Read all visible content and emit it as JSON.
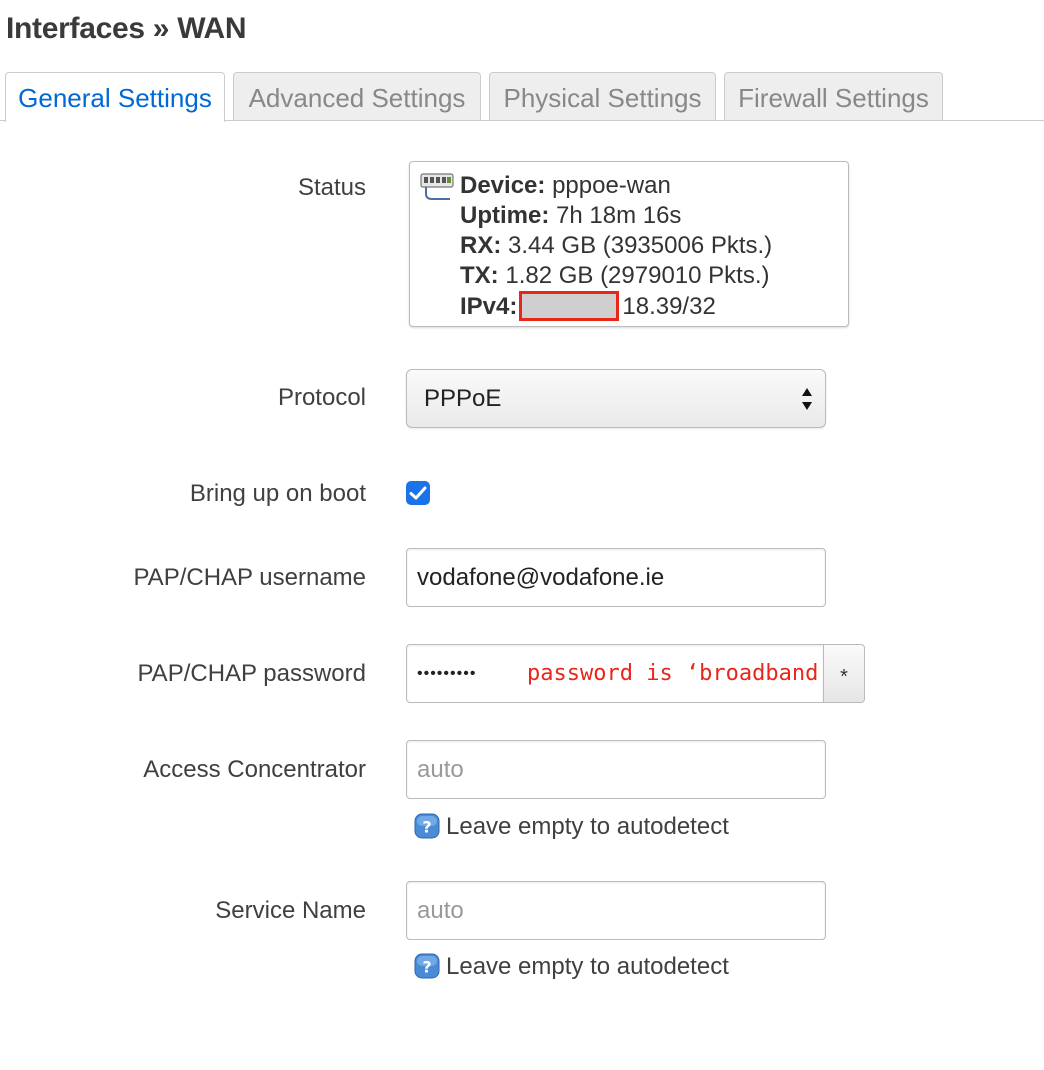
{
  "page": {
    "title": "Interfaces » WAN"
  },
  "tabs": [
    {
      "label": "General Settings",
      "active": true
    },
    {
      "label": "Advanced Settings",
      "active": false
    },
    {
      "label": "Physical Settings",
      "active": false
    },
    {
      "label": "Firewall Settings",
      "active": false
    }
  ],
  "status": {
    "label": "Status",
    "device_key": "Device:",
    "device_value": "pppoe-wan",
    "uptime_key": "Uptime:",
    "uptime_value": "7h 18m 16s",
    "rx_key": "RX:",
    "rx_value": "3.44 GB (3935006 Pkts.)",
    "tx_key": "TX:",
    "tx_value": "1.82 GB (2979010 Pkts.)",
    "ipv4_key": "IPv4:",
    "ipv4_visible_suffix": "18.39/32"
  },
  "protocol": {
    "label": "Protocol",
    "selected": "PPPoE"
  },
  "boot": {
    "label": "Bring up on boot",
    "checked": true
  },
  "username": {
    "label": "PAP/CHAP username",
    "value": "vodafone@vodafone.ie"
  },
  "password": {
    "label": "PAP/CHAP password",
    "masked": "•••••••••",
    "annotation": "password is ‘broadband’",
    "reveal_label": "*"
  },
  "access_concentrator": {
    "label": "Access Concentrator",
    "placeholder": "auto",
    "help": "Leave empty to autodetect"
  },
  "service_name": {
    "label": "Service Name",
    "placeholder": "auto",
    "help": "Leave empty to autodetect"
  },
  "colors": {
    "active_tab": "#0069d6",
    "checkbox": "#1a73e8",
    "annotation": "#e8261a"
  },
  "icons": {
    "status": "network-interface-icon",
    "help": "help-question-icon",
    "select": "select-arrows-icon",
    "checkbox": "checkmark-icon"
  }
}
